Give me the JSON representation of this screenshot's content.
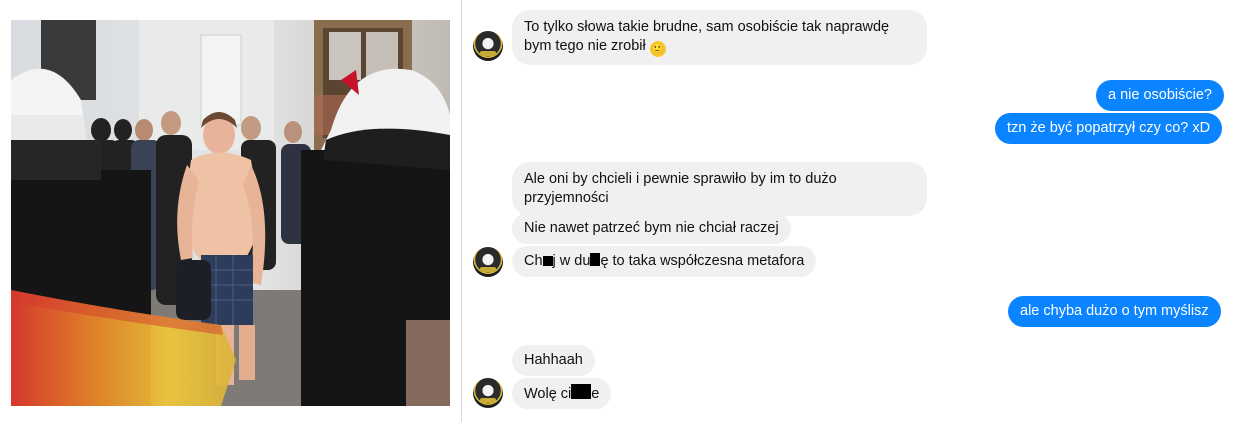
{
  "conversation": {
    "messages": [
      {
        "id": "m1",
        "side": "in",
        "text": "To tylko słowa takie brudne, sam osobiście tak naprawdę bym tego nie zrobił",
        "emoji": "🙂"
      },
      {
        "id": "m2",
        "side": "out",
        "text": "a nie osobiście?"
      },
      {
        "id": "m3",
        "side": "out",
        "text": "tzn że być popatrzył czy co? xD"
      },
      {
        "id": "m4",
        "side": "in",
        "text": "Ale oni by chcieli i pewnie sprawiło by im to dużo przyjemności"
      },
      {
        "id": "m5",
        "side": "in",
        "text": "Nie nawet patrzeć bym nie chciał raczej"
      },
      {
        "id": "m6",
        "side": "in",
        "parts": [
          "Ch",
          "j w du",
          "ę to taka współczesna metafora"
        ]
      },
      {
        "id": "m7",
        "side": "out",
        "text": "ale chyba dużo o tym myślisz"
      },
      {
        "id": "m8",
        "side": "in",
        "text": "Hahhaah"
      },
      {
        "id": "m9",
        "side": "in",
        "parts": [
          "Wolę ci",
          "e"
        ]
      }
    ]
  },
  "colors": {
    "outgoing_bubble": "#0b84ff",
    "incoming_bubble": "#f0f0f0"
  }
}
